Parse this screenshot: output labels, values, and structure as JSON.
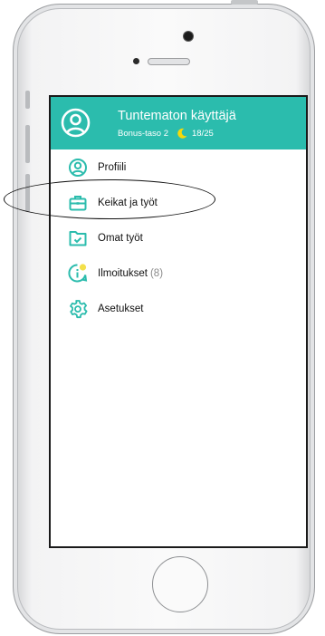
{
  "header": {
    "user_name": "Tuntematon käyttäjä",
    "bonus_level": "Bonus-taso 2",
    "bonus_progress": "18/25",
    "accent_color": "#2bbcad",
    "moon_color": "#f5d90a"
  },
  "menu": {
    "items": [
      {
        "label": "Profiili",
        "icon": "user-circle-icon"
      },
      {
        "label": "Keikat ja työt",
        "icon": "briefcase-icon"
      },
      {
        "label": "Omat työt",
        "icon": "folder-check-icon"
      },
      {
        "label": "Ilmoitukset",
        "count": "(8)",
        "icon": "info-notification-icon"
      },
      {
        "label": "Asetukset",
        "icon": "gear-icon"
      }
    ]
  }
}
